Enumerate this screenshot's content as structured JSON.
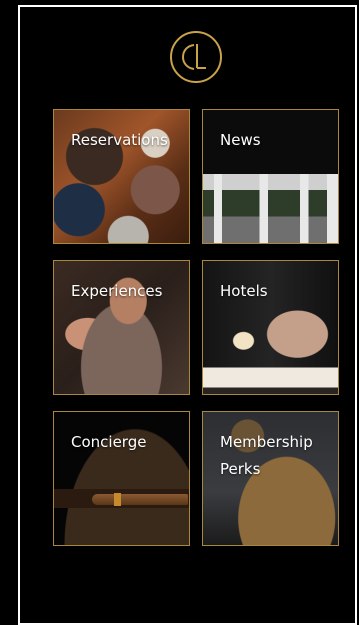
{
  "colors": {
    "background": "#000000",
    "frame": "#ffffff",
    "gold": "#c9a24a",
    "tile_border": "#a8873f",
    "text": "#ffffff"
  },
  "logo": {
    "icon": "cl-monogram-icon"
  },
  "tiles": [
    {
      "label": "Reservations"
    },
    {
      "label": "News"
    },
    {
      "label": "Experiences"
    },
    {
      "label": "Hotels"
    },
    {
      "label": "Concierge"
    },
    {
      "label": "Membership\nPerks"
    }
  ]
}
